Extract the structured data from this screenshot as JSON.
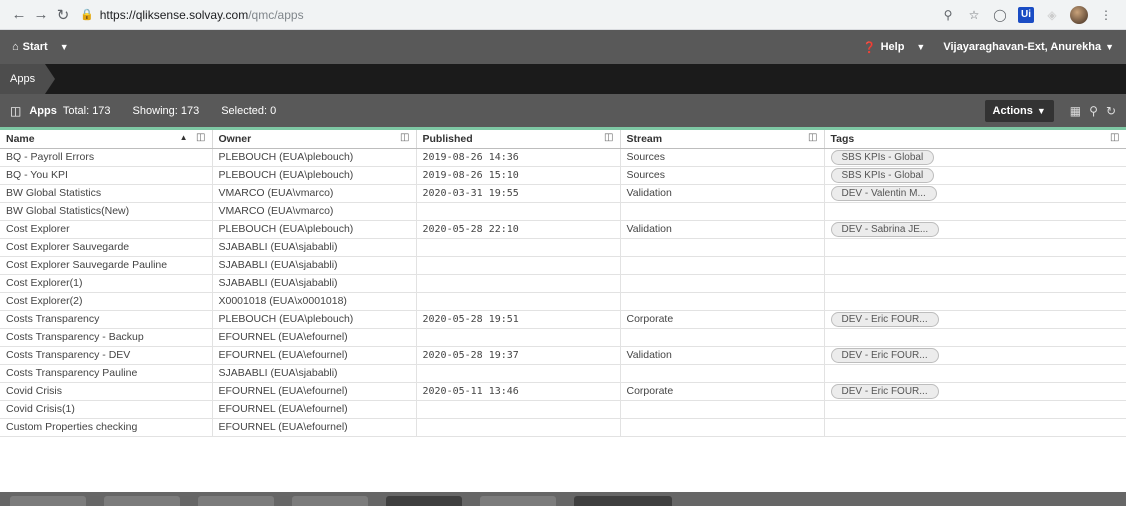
{
  "browser": {
    "url_host": "https://qliksense.solvay.com",
    "url_path": "/qmc/apps"
  },
  "topnav": {
    "start_label": "Start",
    "help_label": "Help",
    "user_name": "Vijayaraghavan-Ext, Anurekha"
  },
  "breadcrumb": {
    "current": "Apps"
  },
  "toolbar": {
    "title": "Apps",
    "total_label": "Total: 173",
    "showing_label": "Showing: 173",
    "selected_label": "Selected: 0",
    "actions_label": "Actions"
  },
  "table": {
    "columns": [
      "Name",
      "Owner",
      "Published",
      "Stream",
      "Tags"
    ],
    "rows": [
      {
        "name": "BQ - Payroll Errors",
        "owner": "PLEBOUCH (EUA\\plebouch)",
        "published": "2019-08-26 14:36",
        "stream": "Sources",
        "tag": "SBS KPIs - Global"
      },
      {
        "name": "BQ - You KPI",
        "owner": "PLEBOUCH (EUA\\plebouch)",
        "published": "2019-08-26 15:10",
        "stream": "Sources",
        "tag": "SBS KPIs - Global"
      },
      {
        "name": "BW Global Statistics",
        "owner": "VMARCO (EUA\\vmarco)",
        "published": "2020-03-31 19:55",
        "stream": "Validation",
        "tag": "DEV - Valentin M..."
      },
      {
        "name": "BW Global Statistics(New)",
        "owner": "VMARCO (EUA\\vmarco)",
        "published": "",
        "stream": "",
        "tag": ""
      },
      {
        "name": "Cost Explorer",
        "owner": "PLEBOUCH (EUA\\plebouch)",
        "published": "2020-05-28 22:10",
        "stream": "Validation",
        "tag": "DEV - Sabrina JE..."
      },
      {
        "name": "Cost Explorer Sauvegarde",
        "owner": "SJABABLI (EUA\\sjababli)",
        "published": "",
        "stream": "",
        "tag": ""
      },
      {
        "name": "Cost Explorer Sauvegarde Pauline",
        "owner": "SJABABLI (EUA\\sjababli)",
        "published": "",
        "stream": "",
        "tag": ""
      },
      {
        "name": "Cost Explorer(1)",
        "owner": "SJABABLI (EUA\\sjababli)",
        "published": "",
        "stream": "",
        "tag": ""
      },
      {
        "name": "Cost Explorer(2)",
        "owner": "X0001018 (EUA\\x0001018)",
        "published": "",
        "stream": "",
        "tag": ""
      },
      {
        "name": "Costs Transparency",
        "owner": "PLEBOUCH (EUA\\plebouch)",
        "published": "2020-05-28 19:51",
        "stream": "Corporate",
        "tag": "DEV - Eric FOUR..."
      },
      {
        "name": "Costs Transparency - Backup",
        "owner": "EFOURNEL (EUA\\efournel)",
        "published": "",
        "stream": "",
        "tag": ""
      },
      {
        "name": "Costs Transparency - DEV",
        "owner": "EFOURNEL (EUA\\efournel)",
        "published": "2020-05-28 19:37",
        "stream": "Validation",
        "tag": "DEV - Eric FOUR..."
      },
      {
        "name": "Costs Transparency Pauline",
        "owner": "SJABABLI (EUA\\sjababli)",
        "published": "",
        "stream": "",
        "tag": ""
      },
      {
        "name": "Covid Crisis",
        "owner": "EFOURNEL (EUA\\efournel)",
        "published": "2020-05-11 13:46",
        "stream": "Corporate",
        "tag": "DEV - Eric FOUR..."
      },
      {
        "name": "Covid Crisis(1)",
        "owner": "EFOURNEL (EUA\\efournel)",
        "published": "",
        "stream": "",
        "tag": ""
      },
      {
        "name": "Custom Properties checking",
        "owner": "EFOURNEL (EUA\\efournel)",
        "published": "",
        "stream": "",
        "tag": ""
      }
    ]
  }
}
